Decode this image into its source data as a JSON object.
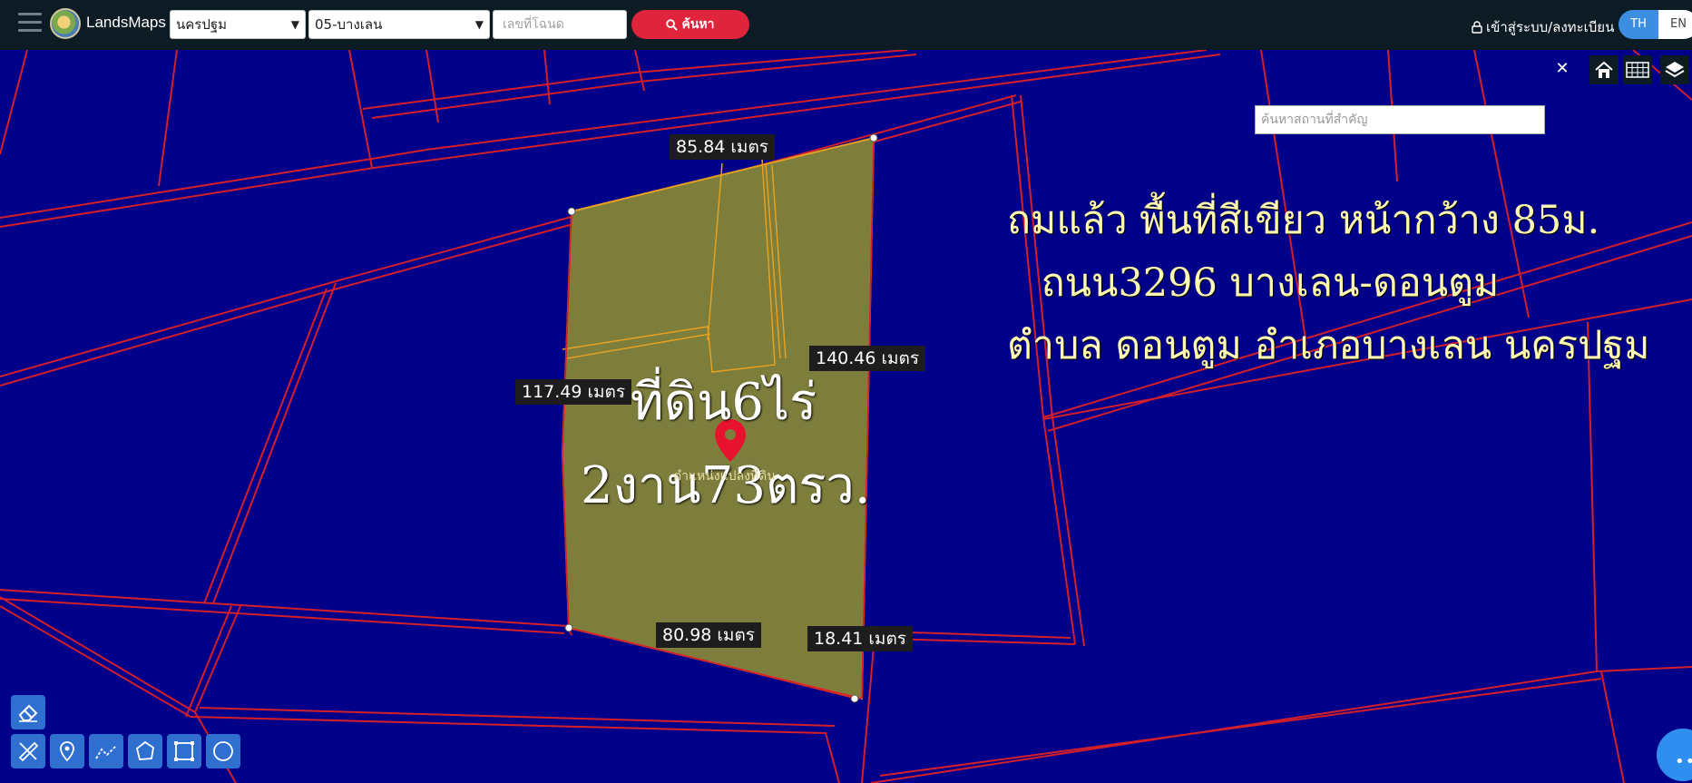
{
  "header": {
    "brand": "LandsMaps",
    "province": "นครปฐม",
    "amphur": "05-บางเลน",
    "deed_placeholder": "เลขที่โฉนด",
    "search_label": "ค้นหา",
    "login_label": "เข้าสู่ระบบ/ลงทะเบียน",
    "lang_th": "TH",
    "lang_en": "EN"
  },
  "map": {
    "place_search_placeholder": "ค้นหาสถานที่สำคัญ",
    "clear_symbol": "✕",
    "distances": {
      "top": "85.84 เมตร",
      "right": "140.46 เมตร",
      "left": "117.49 เมตร",
      "bottom": "80.98 เมตร",
      "bottom_right": "18.41 เมตร"
    },
    "parcel_area_line1": "ที่ดิน6ไร่",
    "parcel_area_line2": "2งาน73ตรว.",
    "pin_label": "ตำแหน่งแปลงที่ดิน",
    "description": [
      "ถมแล้ว พื้นที่สีเขียว หน้ากว้าง 85ม.",
      "ถนน3296 บางเลน-ดอนตูม",
      "ตำบล ดอนตูม อำเภอบางเลน นครปฐม"
    ],
    "chat_symbol": "•••"
  },
  "colors": {
    "map_background": "#000088",
    "parcel_fill": "#7d7d3c",
    "parcel_boundary": "#e8a020",
    "plot_lines": "#d21f2a",
    "search_button": "#e0243b",
    "lang_active": "#3b8ee0",
    "overlay_text": "#fff8b0"
  },
  "icons": [
    "menu-icon",
    "search-icon",
    "lock-icon",
    "home-icon",
    "grid-icon",
    "layers-icon",
    "eraser-icon",
    "ruler-icon",
    "marker-icon",
    "polyline-icon",
    "polygon-icon",
    "rectangle-icon",
    "circle-icon",
    "map-pin-icon"
  ]
}
